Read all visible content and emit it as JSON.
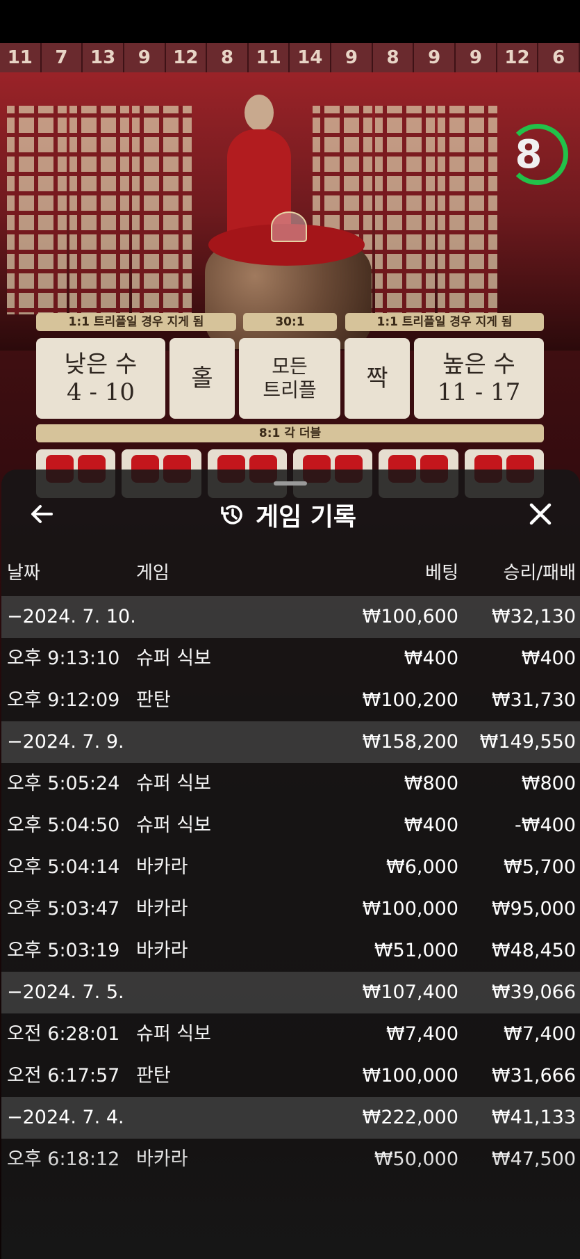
{
  "road": {
    "values": [
      "11",
      "7",
      "13",
      "9",
      "12",
      "8",
      "11",
      "14",
      "9",
      "8",
      "9",
      "9",
      "12",
      "6"
    ]
  },
  "timer": {
    "value": "8",
    "color": "#22c149"
  },
  "bet_board": {
    "payout_left": "1:1 트리플일 경우 지게 됨",
    "payout_mid": "30:1",
    "payout_right": "1:1 트리플일 경우 지게 됨",
    "low": {
      "label": "낮은 수",
      "range": "4 - 10"
    },
    "odd": "홀",
    "any_triple": {
      "line1": "모든",
      "line2": "트리플"
    },
    "even": "짝",
    "high": {
      "label": "높은 수",
      "range": "11 - 17"
    },
    "double_bar": "8:1 각 더블"
  },
  "history": {
    "title": "게임 기록",
    "back_icon": "arrow-left-icon",
    "history_icon": "history-clock-icon",
    "close_icon": "close-icon",
    "columns": {
      "date": "날짜",
      "game": "게임",
      "bet": "베팅",
      "win": "승리/패배"
    },
    "groups": [
      {
        "date": "−2024. 7. 10.",
        "bet": "₩100,600",
        "win": "₩32,130",
        "items": [
          {
            "time": "오후 9:13:10",
            "game": "슈퍼 식보",
            "bet": "₩400",
            "win": "₩400"
          },
          {
            "time": "오후 9:12:09",
            "game": "판탄",
            "bet": "₩100,200",
            "win": "₩31,730"
          }
        ]
      },
      {
        "date": "−2024. 7. 9.",
        "bet": "₩158,200",
        "win": "₩149,550",
        "items": [
          {
            "time": "오후 5:05:24",
            "game": "슈퍼 식보",
            "bet": "₩800",
            "win": "₩800"
          },
          {
            "time": "오후 5:04:50",
            "game": "슈퍼 식보",
            "bet": "₩400",
            "win": "-₩400"
          },
          {
            "time": "오후 5:04:14",
            "game": "바카라",
            "bet": "₩6,000",
            "win": "₩5,700"
          },
          {
            "time": "오후 5:03:47",
            "game": "바카라",
            "bet": "₩100,000",
            "win": "₩95,000"
          },
          {
            "time": "오후 5:03:19",
            "game": "바카라",
            "bet": "₩51,000",
            "win": "₩48,450"
          }
        ]
      },
      {
        "date": "−2024. 7. 5.",
        "bet": "₩107,400",
        "win": "₩39,066",
        "items": [
          {
            "time": "오전 6:28:01",
            "game": "슈퍼 식보",
            "bet": "₩7,400",
            "win": "₩7,400"
          },
          {
            "time": "오전 6:17:57",
            "game": "판탄",
            "bet": "₩100,000",
            "win": "₩31,666"
          }
        ]
      },
      {
        "date": "−2024. 7. 4.",
        "bet": "₩222,000",
        "win": "₩41,133",
        "items": [
          {
            "time": "오후 6:18:12",
            "game": "바카라",
            "bet": "₩50,000",
            "win": "₩47,500"
          }
        ]
      }
    ]
  }
}
